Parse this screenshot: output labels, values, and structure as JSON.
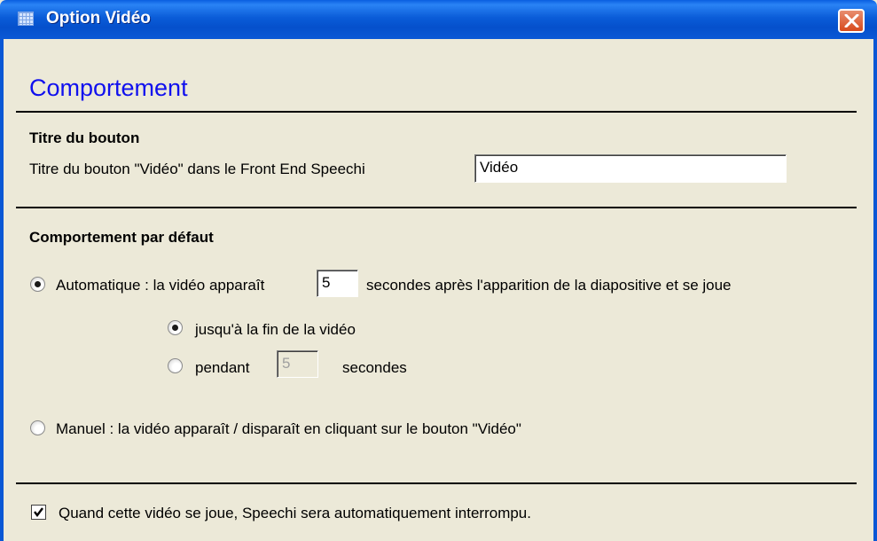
{
  "window": {
    "title": "Option Vidéo"
  },
  "heading": "Comportement",
  "button_title": {
    "section_title": "Titre du bouton",
    "field_label": "Titre du bouton \"Vidéo\" dans le Front End Speechi",
    "field_value": "Vidéo"
  },
  "default_behavior": {
    "section_title": "Comportement par défaut",
    "auto": {
      "label_before": "Automatique : la vidéo apparaît",
      "delay_value": "5",
      "label_after": "secondes après l'apparition de la diapositive et se joue",
      "selected": true
    },
    "until_end": {
      "label": "jusqu'à la fin de la vidéo",
      "selected": true
    },
    "during": {
      "label": "pendant",
      "value": "5",
      "unit": "secondes",
      "selected": false,
      "disabled": true
    },
    "manual": {
      "label": "Manuel : la vidéo apparaît / disparaît en cliquant sur le bouton \"Vidéo\"",
      "selected": false
    }
  },
  "interrupt_checkbox": {
    "label": "Quand cette vidéo se joue, Speechi sera automatiquement interrompu.",
    "checked": true
  }
}
